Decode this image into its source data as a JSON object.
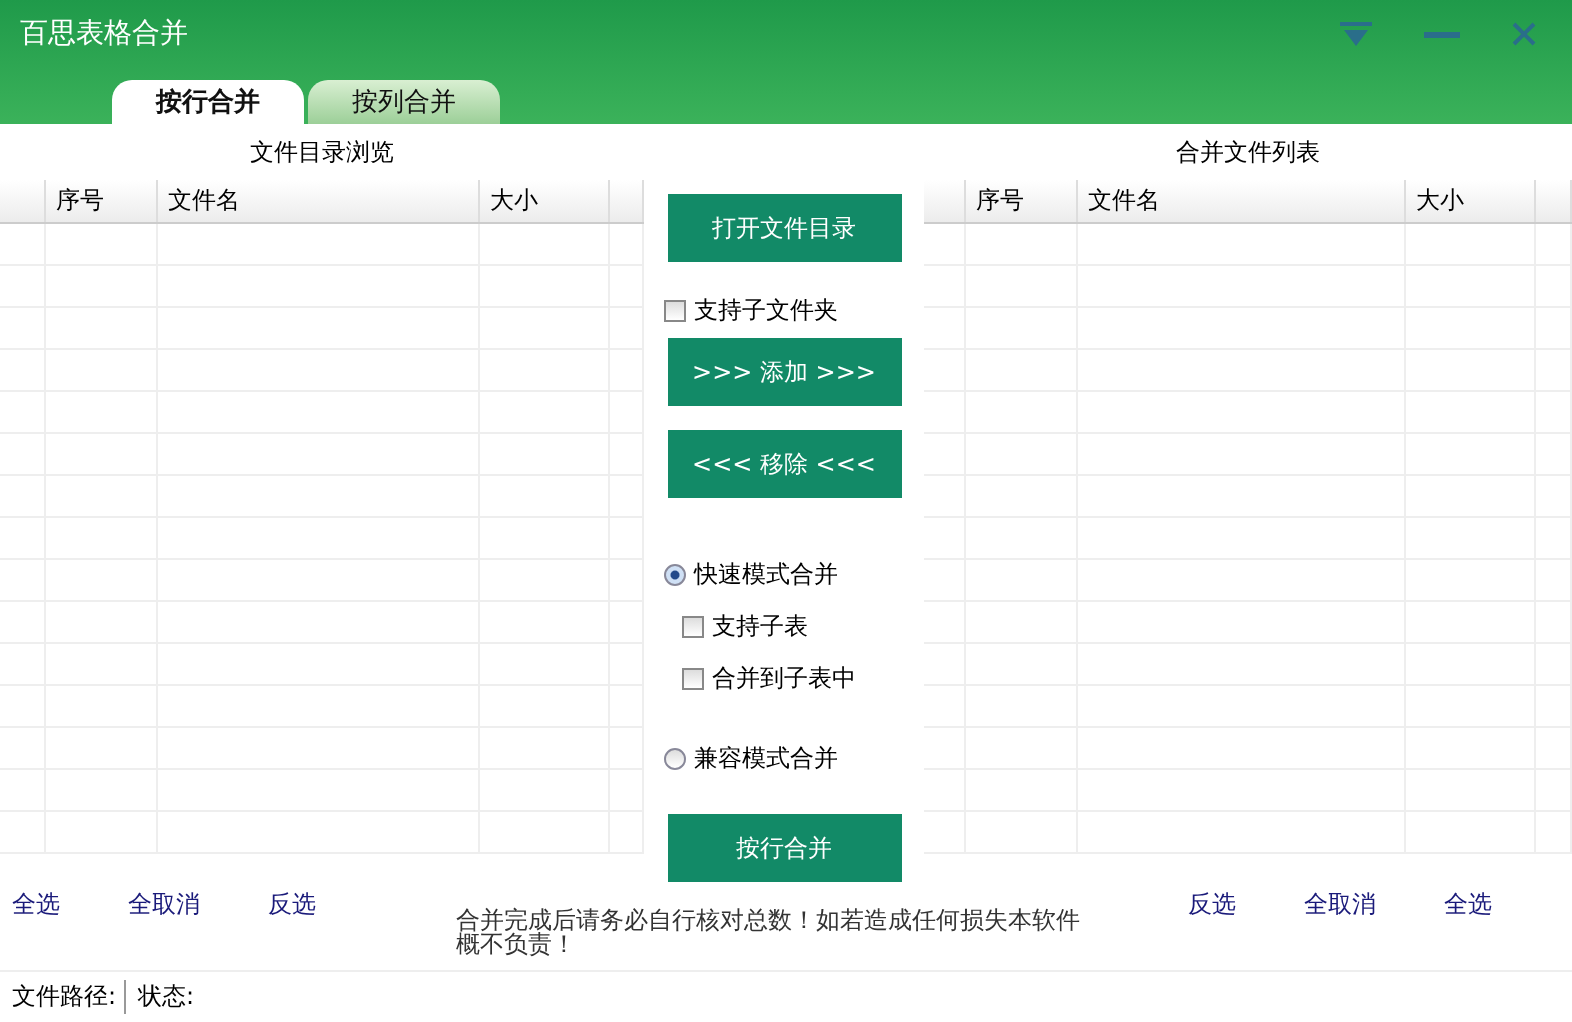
{
  "window": {
    "title": "百思表格合并"
  },
  "tabs": [
    {
      "label": "按行合并",
      "selected": true
    },
    {
      "label": "按列合并",
      "selected": false
    }
  ],
  "left_panel": {
    "title": "文件目录浏览",
    "columns": [
      "序号",
      "文件名",
      "大小"
    ],
    "links": [
      "全选",
      "全取消",
      "反选"
    ]
  },
  "right_panel": {
    "title": "合并文件列表",
    "columns": [
      "序号",
      "文件名",
      "大小"
    ],
    "links": [
      "反选",
      "全取消",
      "全选"
    ]
  },
  "controls": [
    {
      "kind": "button",
      "label": "打开文件目录"
    },
    {
      "kind": "checkbox",
      "label": "支持子文件夹",
      "checked": false
    },
    {
      "kind": "button",
      "label": ">>> 添加 >>>"
    },
    {
      "kind": "button",
      "label": "<<< 移除 <<<"
    },
    {
      "kind": "radio",
      "label": "快速模式合并",
      "selected": true
    },
    {
      "kind": "option",
      "label": "支持子表",
      "checked": false
    },
    {
      "kind": "option",
      "label": "合并到子表中",
      "checked": false
    },
    {
      "kind": "radio",
      "label": "兼容模式合并",
      "selected": false
    },
    {
      "kind": "button",
      "label": "按行合并"
    }
  ],
  "notice": "合并完成后请务必自行核对总数！如若造成任何损失本软件概不负责！",
  "status_bar": {
    "path_label": "文件路径:",
    "state_label": "状态:"
  }
}
